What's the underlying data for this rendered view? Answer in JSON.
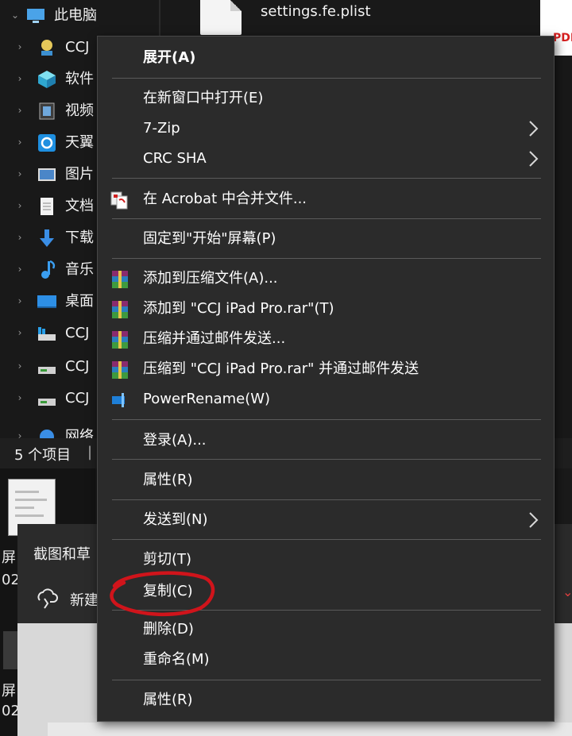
{
  "nav": {
    "items": [
      {
        "label": "此电脑",
        "icon": "computer-icon"
      },
      {
        "label": "CCJ",
        "icon": "network-drive-icon"
      },
      {
        "label": "软件",
        "icon": "cube-icon"
      },
      {
        "label": "视频",
        "icon": "video-icon"
      },
      {
        "label": "天翼",
        "icon": "sync-icon"
      },
      {
        "label": "图片",
        "icon": "picture-icon"
      },
      {
        "label": "文档",
        "icon": "document-icon"
      },
      {
        "label": "下载",
        "icon": "download-icon"
      },
      {
        "label": "音乐",
        "icon": "music-icon"
      },
      {
        "label": "桌面",
        "icon": "desktop-icon"
      },
      {
        "label": "CCJ",
        "icon": "drive-icon"
      },
      {
        "label": "CCJ",
        "icon": "drive-icon"
      },
      {
        "label": "CCJ",
        "icon": "drive-icon"
      }
    ],
    "partial_label": "网络"
  },
  "files": {
    "name": "settings.fe.plist",
    "pdf_badge": "PDF"
  },
  "status": {
    "count": "5 个项目",
    "separator": "|"
  },
  "background": {
    "peek_1": "屏",
    "peek_2": "02",
    "peek_3": "屏",
    "peek_4": "02",
    "snip_title": "截图和草",
    "snip_new": "新建"
  },
  "menu": {
    "items": [
      {
        "label": "展开(A)",
        "bold": true
      },
      {
        "label": "在新窗口中打开(E)"
      },
      {
        "label": "7-Zip",
        "submenu": true
      },
      {
        "label": "CRC SHA",
        "submenu": true
      },
      {
        "label": "在 Acrobat 中合并文件...",
        "icon": "acrobat-icon"
      },
      {
        "label": "固定到\"开始\"屏幕(P)"
      },
      {
        "label": "添加到压缩文件(A)...",
        "icon": "winrar-icon"
      },
      {
        "label": "添加到 \"CCJ iPad Pro.rar\"(T)",
        "icon": "winrar-icon"
      },
      {
        "label": "压缩并通过邮件发送...",
        "icon": "winrar-icon"
      },
      {
        "label": "压缩到 \"CCJ iPad Pro.rar\" 并通过邮件发送",
        "icon": "winrar-icon"
      },
      {
        "label": "PowerRename(W)",
        "icon": "powerrename-icon"
      },
      {
        "label": "登录(A)..."
      },
      {
        "label": "属性(R)"
      },
      {
        "label": "发送到(N)",
        "submenu": true
      },
      {
        "label": "剪切(T)"
      },
      {
        "label": "复制(C)",
        "highlighted_by_annotation": true
      },
      {
        "label": "删除(D)"
      },
      {
        "label": "重命名(M)"
      },
      {
        "label": "属性(R)"
      }
    ]
  },
  "colors": {
    "menu_bg": "#2b2b2b",
    "annotation": "#d0141b",
    "accent_blue": "#1e90ff"
  }
}
